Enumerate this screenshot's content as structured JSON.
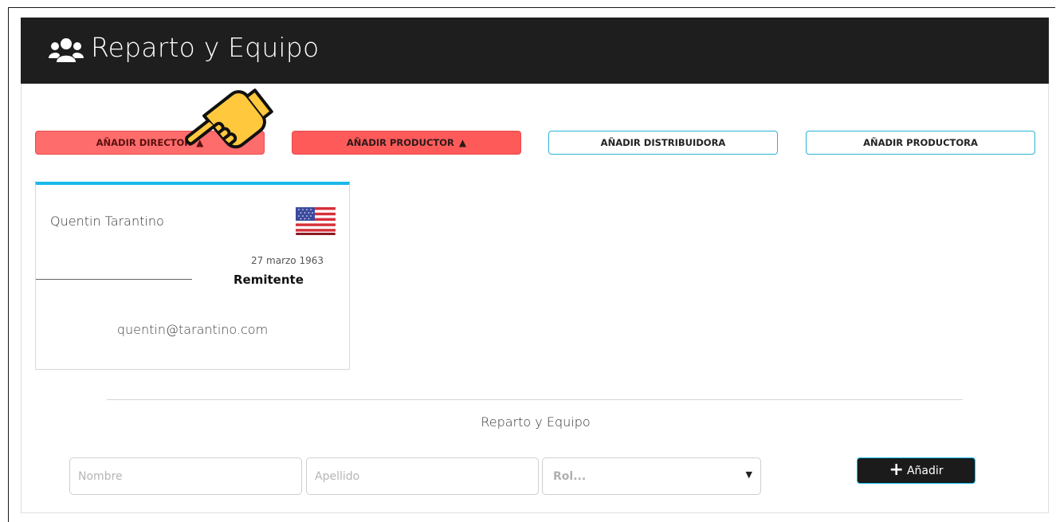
{
  "header": {
    "title": "Reparto y Equipo",
    "icon": "users-icon"
  },
  "actions": [
    {
      "label": "AÑADIR DIRECTOR",
      "warning": "▲",
      "style": "red-light"
    },
    {
      "label": "AÑADIR PRODUCTOR",
      "warning": "▲",
      "style": "red"
    },
    {
      "label": "AÑADIR DISTRIBUIDORA",
      "style": "outline"
    },
    {
      "label": "AÑADIR PRODUCTORA",
      "style": "outline"
    }
  ],
  "card": {
    "name": "Quentin Tarantino",
    "flag": "us-flag-icon",
    "date": "27 marzo 1963",
    "role": "Remitente",
    "email": "quentin@tarantino.com"
  },
  "form": {
    "section_title": "Reparto y Equipo",
    "first_name_placeholder": "Nombre",
    "last_name_placeholder": "Apellido",
    "role_select_value": "Rol...",
    "add_label": "Añadir"
  },
  "colors": {
    "accent": "#1ab9e8",
    "danger": "#ff5a5a",
    "header": "#1e1e1e"
  }
}
